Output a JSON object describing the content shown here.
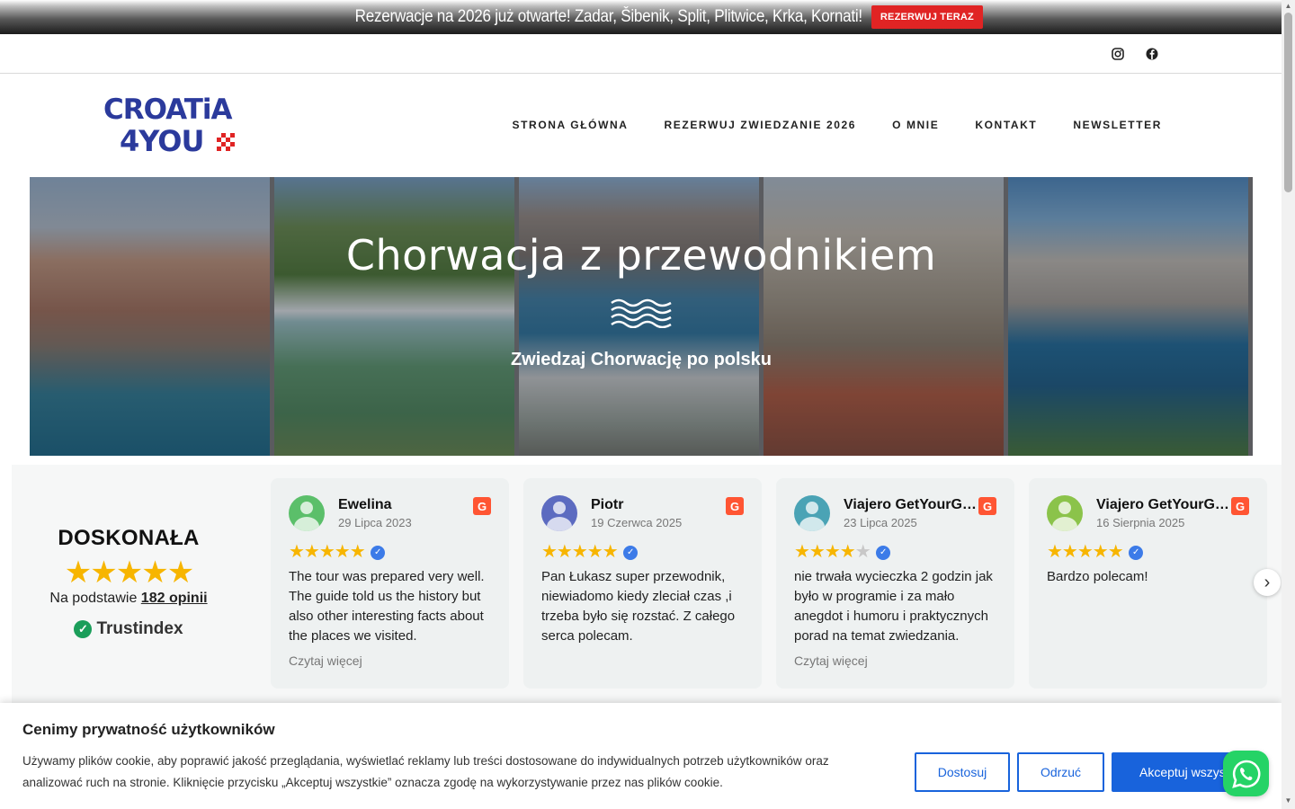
{
  "promo": {
    "text": "Rezerwacje na 2026 już otwarte! Zadar, Šibenik, Split, Plitwice, Krka, Kornati!",
    "button_label": "REZERWUJ TERAZ",
    "button_color": "#e02424"
  },
  "social": {
    "icons": [
      "instagram-icon",
      "facebook-icon"
    ]
  },
  "header": {
    "logo_line1": "CROATiA",
    "logo_line2": "4YOU",
    "nav": [
      "STRONA GŁÓWNA",
      "REZERWUJ ZWIEDZANIE 2026",
      "O MNIE",
      "KONTAKT",
      "NEWSLETTER"
    ]
  },
  "hero": {
    "title": "Chorwacja z przewodnikiem",
    "subtitle": "Zwiedzaj Chorwację po polsku"
  },
  "reviews": {
    "summary": {
      "title": "DOSKONAŁA",
      "stars": "★★★★★",
      "basis_prefix": "Na podstawie",
      "basis_link": "182 opinii",
      "brand": "Trustindex"
    },
    "items": [
      {
        "name": "Ewelina",
        "date": "29 Lipca 2023",
        "rating": 5,
        "text": "The tour was prepared very well. The guide told us the history but also other interesting facts about the places we visited.",
        "more": "Czytaj więcej",
        "avatar_color": "#5bbf6a"
      },
      {
        "name": "Piotr",
        "date": "19 Czerwca 2025",
        "rating": 5,
        "text": "Pan Łukasz super przewodnik, niewiadomo kiedy zleciał czas ,i trzeba było się rozstać. Z całego serca polecam.",
        "more": "",
        "avatar_color": "#5c6bc0"
      },
      {
        "name": "Viajero GetYourGuide",
        "date": "23 Lipca 2025",
        "rating": 4,
        "text": "nie trwała wycieczka 2 godzin jak było w programie i za mało anegdot i humoru i praktycznych porad na temat zwiedzania.",
        "more": "Czytaj więcej",
        "avatar_color": "#4aa3b5"
      },
      {
        "name": "Viajero GetYourGuide",
        "date": "16 Sierpnia 2025",
        "rating": 5,
        "text": "Bardzo polecam!",
        "more": "",
        "avatar_color": "#8bc34a"
      }
    ],
    "source_badge": "G"
  },
  "cookie": {
    "title": "Cenimy prywatność użytkowników",
    "text": "Używamy plików cookie, aby poprawić jakość przeglądania, wyświetlać reklamy lub treści dostosowane do indywidualnych potrzeb użytkowników oraz analizować ruch na stronie. Kliknięcie przycisku „Akceptuj wszystkie” oznacza zgodę na wykorzystywanie przez nas plików cookie.",
    "customize_label": "Dostosuj",
    "reject_label": "Odrzuć",
    "accept_label": "Akceptuj wszystkie",
    "accent_color": "#1863dc"
  },
  "whatsapp": {
    "icon": "whatsapp-icon",
    "color": "#25d366"
  }
}
